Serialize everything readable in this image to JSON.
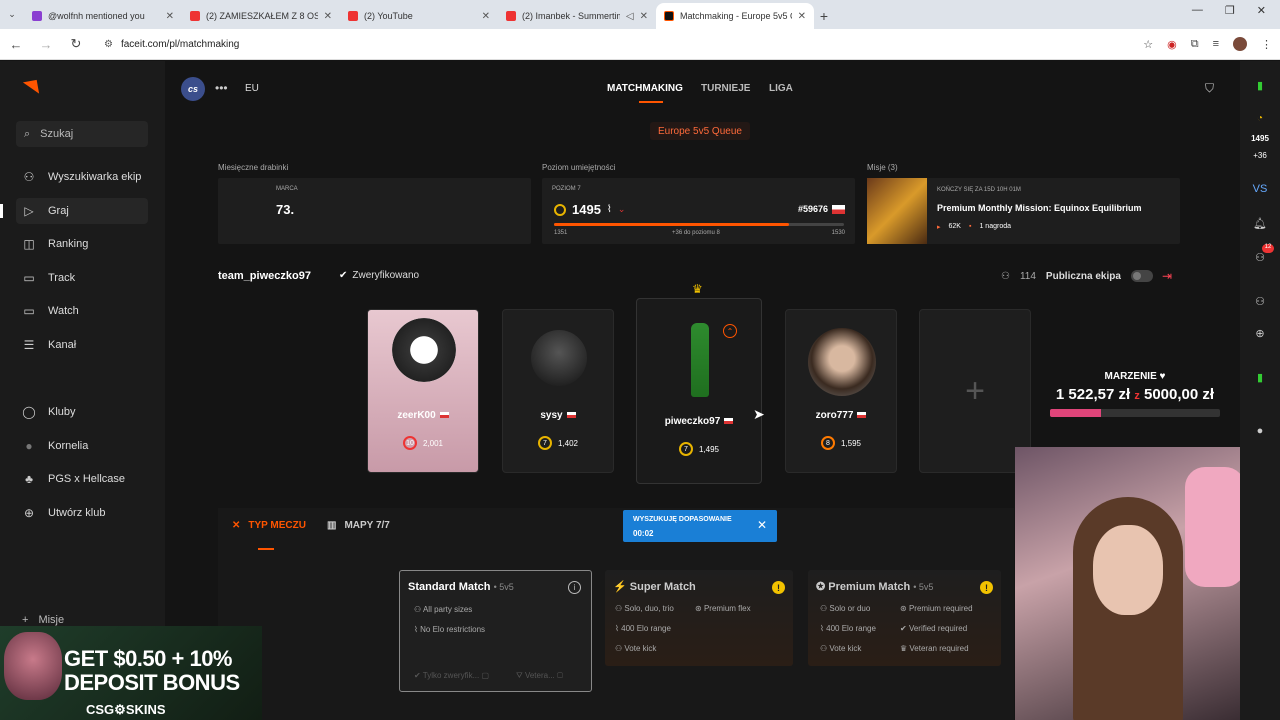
{
  "browser": {
    "tabs": [
      {
        "title": "@wolfnh mentioned you",
        "color": "#8a3fd1"
      },
      {
        "title": "(2) ZAMIESZKAŁEM Z 8 OSOBO",
        "color": "#e33"
      },
      {
        "title": "(2) YouTube",
        "color": "#e33"
      },
      {
        "title": "(2) Imanbek - Summertime",
        "color": "#e33"
      },
      {
        "title": "Matchmaking - Europe 5v5 Que",
        "color": "#111"
      }
    ],
    "url": "faceit.com/pl/matchmaking"
  },
  "sidebar": {
    "search_label": "Szukaj",
    "items": [
      {
        "label": "Wyszukiwarka ekip",
        "icon": "team-search-icon",
        "glyph": "⚇"
      },
      {
        "label": "Graj",
        "icon": "play-icon",
        "glyph": "▷"
      },
      {
        "label": "Ranking",
        "icon": "ranking-icon",
        "glyph": "◫"
      },
      {
        "label": "Track",
        "icon": "track-icon",
        "glyph": "▭"
      },
      {
        "label": "Watch",
        "icon": "watch-icon",
        "glyph": "▭"
      },
      {
        "label": "Kanał",
        "icon": "channel-icon",
        "glyph": "☰"
      }
    ],
    "clubs": [
      {
        "label": "Kluby",
        "icon": "clubs-icon",
        "glyph": "◯"
      },
      {
        "label": "Kornelia",
        "icon": "club-avatar-icon",
        "glyph": "●"
      },
      {
        "label": "PGS x Hellcase",
        "icon": "club-avatar-icon",
        "glyph": "♣"
      },
      {
        "label": "Utwórz klub",
        "icon": "create-club-icon",
        "glyph": "⊕"
      }
    ],
    "misje_label": "Misje"
  },
  "promo": {
    "line1": "GET $0.50 + 10%",
    "line2": "DEPOSIT BONUS",
    "brand": "CSG⚙SKINS"
  },
  "topnav": {
    "game": "cs",
    "region": "EU",
    "tabs": [
      "MATCHMAKING",
      "TURNIEJE",
      "LIGA"
    ],
    "queue": "Europe 5v5 Queue"
  },
  "stats": {
    "ladder_label": "Miesięczne drabinki",
    "ladder_month": "MARCA",
    "ladder_place": "73.",
    "skill_label": "Poziom umiejętności",
    "skill_level": "POZIOM 7",
    "elo": "1495",
    "rank": "#59676",
    "range_min": "1351",
    "range_hint": "+36 do poziomu 8",
    "range_max": "1530",
    "level_progress": 0.81,
    "missions_label": "Misje (3)",
    "mission_ends": "KOŃCZY SIĘ ZA 15D 10H 01M",
    "mission_title": "Premium Monthly Mission: Equinox Equilibrium",
    "mission_points": "62K",
    "mission_reward": "1 nagroda"
  },
  "party": {
    "name": "team_piweczko97",
    "verified": "Zweryfikowano",
    "members_count": "114",
    "public_label": "Publiczna ekipa",
    "players": [
      {
        "name": "zeerK00",
        "level": "10",
        "elo": "2,001"
      },
      {
        "name": "sysy",
        "level": "7",
        "elo": "1,402"
      },
      {
        "name": "piweczko97",
        "level": "7",
        "elo": "1,495"
      },
      {
        "name": "zoro777",
        "level": "8",
        "elo": "1,595"
      }
    ]
  },
  "matchmaking": {
    "tab_type": "TYP MECZU",
    "tab_maps": "MAPY 7/7",
    "searching_label": "WYSZUKUJĘ DOPASOWANIE",
    "searching_time": "00:02",
    "cards": [
      {
        "title": "Standard Match",
        "sub": "• 5v5",
        "f1": "All party sizes",
        "f2": "No Elo restrictions",
        "opt1": "Tylko zweryfik...",
        "opt2": "Vetera..."
      },
      {
        "title": "Super Match",
        "sub": "",
        "f1": "Solo, duo, trio",
        "f2": "Premium flex",
        "f3": "400 Elo range",
        "f4": "Vote kick"
      },
      {
        "title": "Premium Match",
        "sub": "• 5v5",
        "f1": "Solo or duo",
        "f2": "Premium required",
        "f3": "400 Elo range",
        "f4": "Verified required",
        "f5": "Vote kick",
        "f6": "Veteran required"
      }
    ]
  },
  "overlay": {
    "goal_title": "MARZENIE ♥",
    "goal_current": "1 522,57 zł",
    "goal_target": "5000,00 zł",
    "goal_progress": 0.3
  },
  "rail": {
    "elo": "1495",
    "elo_delta": "+36",
    "badge": "12"
  }
}
